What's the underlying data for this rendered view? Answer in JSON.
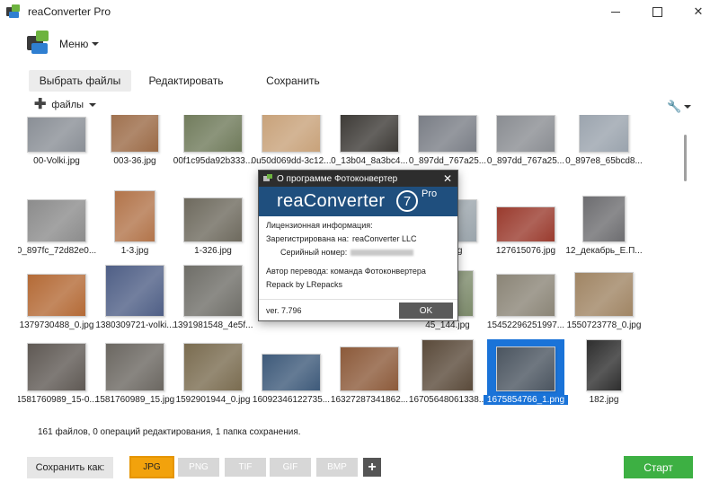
{
  "window": {
    "title": "reaConverter Pro",
    "close_glyph": "✕"
  },
  "menu": {
    "label": "Меню"
  },
  "tabs": [
    {
      "label": "Выбрать файлы"
    },
    {
      "label": "Редактировать"
    },
    {
      "label": "Сохранить"
    }
  ],
  "toolbar": {
    "files_label": "файлы",
    "plus_glyph": "✚",
    "wrench_glyph": "🔧"
  },
  "files": [
    {
      "name": "00-Volki.jpg",
      "color": "#8a8f96"
    },
    {
      "name": "003-36.jpg",
      "color": "#9b6a46"
    },
    {
      "name": "00f1c95da92b333...",
      "color": "#6f7a5a"
    },
    {
      "name": "0u50d069dd-3c12...",
      "color": "#c8a27a"
    },
    {
      "name": "0_13b04_8a3bc4...",
      "color": "#3d3a36"
    },
    {
      "name": "0_897dd_767a25...",
      "color": "#7a7e86"
    },
    {
      "name": "0_897dd_767a25...",
      "color": "#8a8d92"
    },
    {
      "name": "0_897e8_65bcd8...",
      "color": "#9aa3ad"
    },
    {
      "name": "0_897fc_72d82e0...",
      "color": "#8c8c8c"
    },
    {
      "name": "1-3.jpg",
      "color": "#b2744a"
    },
    {
      "name": "1-326.jpg",
      "color": "#6e6a5e"
    },
    {
      "name": "",
      "color": "#bcb7ad"
    },
    {
      "name": "",
      "color": "#a9a9a9"
    },
    {
      "name": "652.jpg",
      "color": "#9aa4ab"
    },
    {
      "name": "127615076.jpg",
      "color": "#9a3b2e"
    },
    {
      "name": "12_декабрь_Е.П...",
      "color": "#6d6d70"
    },
    {
      "name": "1379730488_0.jpg",
      "color": "#b46a36"
    },
    {
      "name": "1380309721-volki...",
      "color": "#4f5f86"
    },
    {
      "name": "1391981548_4e5f...",
      "color": "#6f6e68"
    },
    {
      "name": "",
      "color": "#c9c9c9"
    },
    {
      "name": "",
      "color": "#a0a0a0"
    },
    {
      "name": "45_144.jpg",
      "color": "#7c8a6a"
    },
    {
      "name": "15452296251997...",
      "color": "#8b8577"
    },
    {
      "name": "1550723778_0.jpg",
      "color": "#a08564"
    },
    {
      "name": "1581760989_15-0...",
      "color": "#5f5954"
    },
    {
      "name": "1581760989_15.jpg",
      "color": "#6b6761"
    },
    {
      "name": "1592901944_0.jpg",
      "color": "#7a6c50"
    },
    {
      "name": "16092346122735...",
      "color": "#3e5a7a"
    },
    {
      "name": "16327287341862...",
      "color": "#8c5a3a"
    },
    {
      "name": "16705648061338...",
      "color": "#5a4a3a"
    },
    {
      "name": "1675854766_1.png",
      "color": "#4b5560"
    },
    {
      "name": "182.jpg",
      "color": "#2e2e2e"
    }
  ],
  "selected_file": "1675854766_1.png",
  "status_text": "161 файлов, 0 операций редактирования, 1 папка сохранения.",
  "bottom": {
    "save_as_label": "Сохранить как:",
    "formats": [
      "JPG",
      "PNG",
      "TIF",
      "GIF",
      "BMP"
    ],
    "active_format": "JPG",
    "add_glyph": "+",
    "start_label": "Старт"
  },
  "dialog": {
    "title": "О программе Фотоконвертер",
    "brand": "reaConverter",
    "version_badge": "7",
    "edition": "Pro",
    "license_heading": "Лицензионная информация:",
    "registered_label": "Зарегистрирована на:",
    "registered_to": "reaConverter LLC",
    "serial_label": "Серийный номер:",
    "translation": "Автор перевода: команда Фотоконвертера",
    "repack": "Repack by LRepacks",
    "version": "ver. 7.796",
    "ok_label": "OK"
  },
  "colors": {
    "accent_selected": "#1a73d8",
    "format_active": "#f2a20c",
    "start_button": "#3db043",
    "dialog_banner": "#1f4f7e"
  }
}
